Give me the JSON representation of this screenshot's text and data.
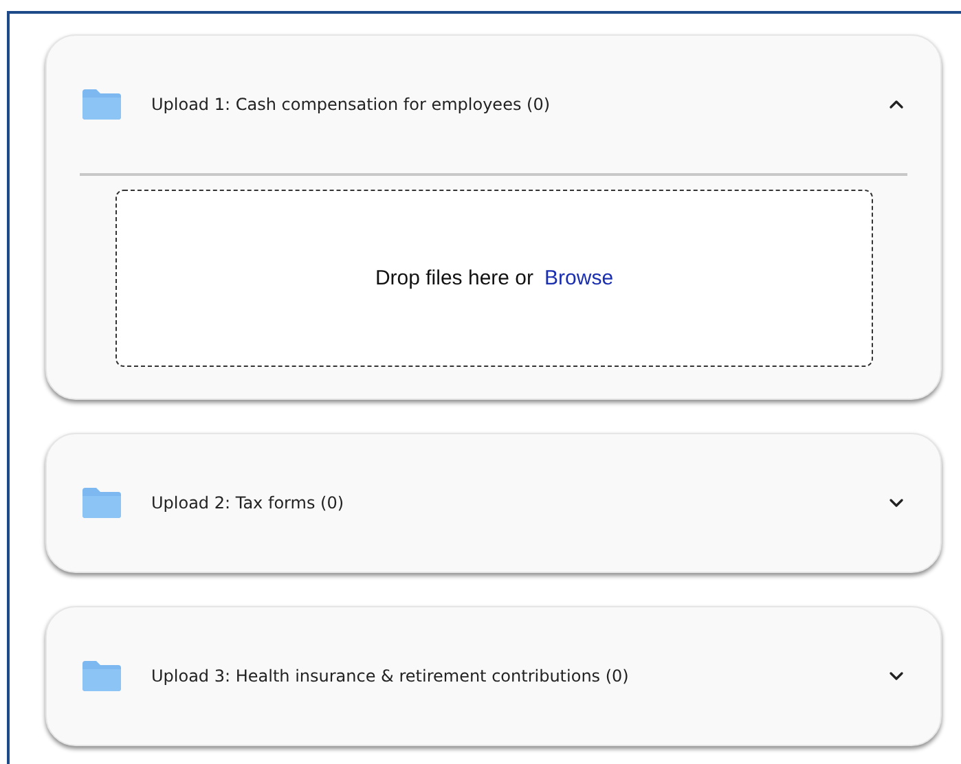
{
  "sections": [
    {
      "title": "Upload 1: Cash compensation for employees (0)",
      "expanded": true,
      "dropzone": {
        "text": "Drop files here or",
        "link": "Browse"
      }
    },
    {
      "title": "Upload 2: Tax forms (0)",
      "expanded": false
    },
    {
      "title": "Upload 3: Health insurance & retirement contributions (0)",
      "expanded": false
    }
  ]
}
